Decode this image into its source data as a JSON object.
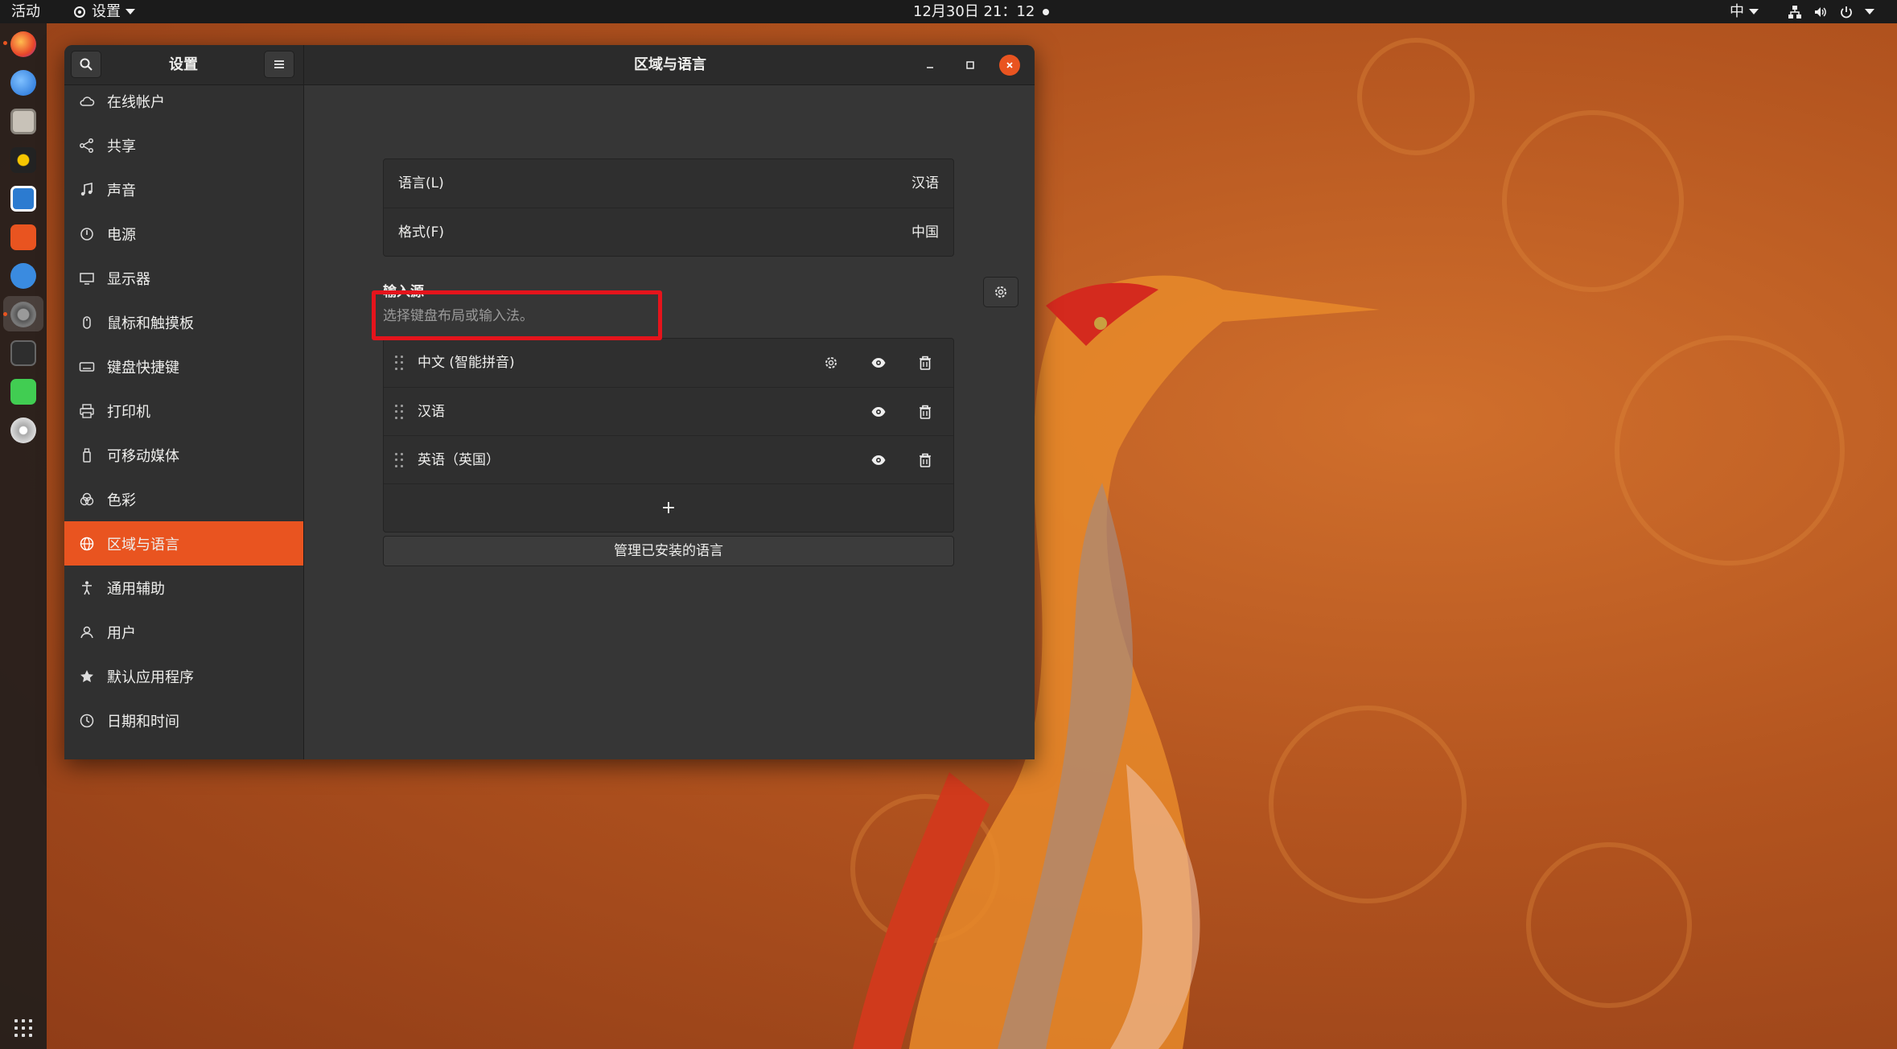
{
  "topbar": {
    "activities": "活动",
    "app_menu_label": "设置",
    "clock": "12月30日 21：12",
    "input_method": "中",
    "tray_icons": [
      "network-icon",
      "volume-icon",
      "power-icon"
    ]
  },
  "dock": {
    "items": [
      "firefox-icon",
      "thunderbird-icon",
      "files-icon",
      "rhythmbox-icon",
      "writer-icon",
      "software-icon",
      "help-icon",
      "settings-icon",
      "terminal-icon",
      "qt-creator-icon",
      "disc-icon"
    ],
    "show_apps_icon": "grid-icon"
  },
  "window": {
    "sidebar_title": "设置",
    "title": "区域与语言"
  },
  "sidebar": {
    "items": [
      {
        "label": "在线帐户",
        "icon": "cloud-icon"
      },
      {
        "label": "共享",
        "icon": "share-icon"
      },
      {
        "label": "声音",
        "icon": "music-note-icon"
      },
      {
        "label": "电源",
        "icon": "power-icon"
      },
      {
        "label": "显示器",
        "icon": "display-icon"
      },
      {
        "label": "鼠标和触摸板",
        "icon": "mouse-icon"
      },
      {
        "label": "键盘快捷键",
        "icon": "keyboard-icon"
      },
      {
        "label": "打印机",
        "icon": "printer-icon"
      },
      {
        "label": "可移动媒体",
        "icon": "removable-media-icon"
      },
      {
        "label": "色彩",
        "icon": "color-icon"
      },
      {
        "label": "区域与语言",
        "icon": "globe-icon"
      },
      {
        "label": "通用辅助",
        "icon": "accessibility-icon"
      },
      {
        "label": "用户",
        "icon": "user-icon"
      },
      {
        "label": "默认应用程序",
        "icon": "star-icon"
      },
      {
        "label": "日期和时间",
        "icon": "clock-icon"
      }
    ],
    "active_index": 10
  },
  "language": {
    "language_label": "语言(L)",
    "language_value": "汉语",
    "format_label": "格式(F)",
    "format_value": "中国"
  },
  "input_sources": {
    "title": "输入源",
    "subtitle": "选择键盘布局或输入法。",
    "items": [
      {
        "label": "中文 (智能拼音)",
        "has_settings": true
      },
      {
        "label": "汉语",
        "has_settings": false
      },
      {
        "label": "英语（英国）",
        "has_settings": false
      }
    ],
    "add_label": "+"
  },
  "manage_button": "管理已安装的语言",
  "colors": {
    "accent": "#e95420",
    "highlight_box": "#e5141c"
  }
}
